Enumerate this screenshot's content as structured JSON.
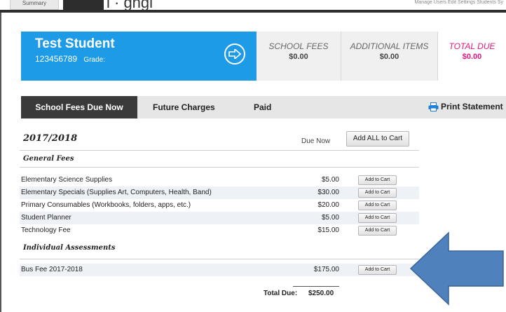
{
  "nav": {
    "summary_tab": "Summary",
    "title_fragment": "i  ·  ghgi",
    "links": "Manage Users   Edit Settings   Students   Sy"
  },
  "student": {
    "name": "Test Student",
    "id": "123456789",
    "grade_label": "Grade:"
  },
  "summary": {
    "school_fees_label": "SCHOOL FEES",
    "school_fees_value": "$0.00",
    "additional_label": "ADDITIONAL ITEMS",
    "additional_value": "$0.00",
    "total_label": "TOTAL DUE",
    "total_value": "$0.00"
  },
  "tabs": {
    "due_now": "School Fees Due Now",
    "future": "Future Charges",
    "paid": "Paid",
    "print": "Print Statement"
  },
  "fees": {
    "year": "2017/2018",
    "due_now_header": "Due Now",
    "add_all_label": "Add ALL to Cart",
    "add_to_cart_label": "Add to Cart",
    "general_heading": "General Fees",
    "general_items": [
      {
        "desc": "Elementary Science Supplies",
        "amount": "$5.00"
      },
      {
        "desc": "Elementary Specials (Supplies Art, Computers, Health, Band)",
        "amount": "$30.00"
      },
      {
        "desc": "Primary Consumables (Workbooks, folders, apps, etc.)",
        "amount": "$20.00"
      },
      {
        "desc": "Student Planner",
        "amount": "$5.00"
      },
      {
        "desc": "Technology Fee",
        "amount": "$15.00"
      }
    ],
    "individual_heading": "Individual Assessments",
    "individual_items": [
      {
        "desc": "Bus Fee 2017-2018",
        "amount": "$175.00"
      }
    ],
    "total_label": "Total Due:",
    "total_value": "$250.00"
  },
  "colors": {
    "student_card": "#1e9be6",
    "active_tab": "#3a3a3a",
    "total_due": "#e0177d",
    "arrow": "#4f81bd"
  },
  "icons": {
    "go": "arrow-circle-right-icon",
    "print": "printer-icon",
    "pointer": "big-left-arrow-icon"
  }
}
